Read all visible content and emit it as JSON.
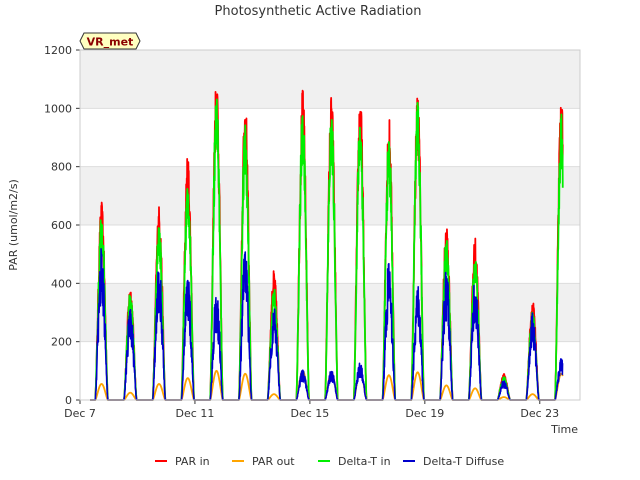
{
  "chart_data": {
    "type": "line",
    "title": "Photosynthetic Active Radiation",
    "xlabel": "Time",
    "ylabel": "PAR (umol/m2/s)",
    "site_label": "VR_met",
    "xlim": [
      0,
      17.4
    ],
    "ylim": [
      0,
      1200
    ],
    "yticks": [
      0,
      200,
      400,
      600,
      800,
      1000,
      1200
    ],
    "xticks": [
      {
        "value": 0,
        "label": "Dec 7"
      },
      {
        "value": 4,
        "label": "Dec 11"
      },
      {
        "value": 8,
        "label": "Dec 15"
      },
      {
        "value": 12,
        "label": "Dec 19"
      },
      {
        "value": 16,
        "label": "Dec 23"
      }
    ],
    "band_colors": [
      "#ffffff",
      "#f0f0f0"
    ],
    "grid": true,
    "legend_position": "bottom",
    "daily_peaks_day_offsets": [
      0.75,
      1.75,
      2.75,
      3.75,
      4.75,
      5.75,
      6.75,
      7.75,
      8.75,
      9.75,
      10.75,
      11.75,
      12.75,
      13.75,
      14.75,
      15.75,
      16.75
    ],
    "series": [
      {
        "name": "PAR in",
        "color": "#ff0000",
        "daily_peaks": [
          680,
          395,
          670,
          845,
          1135,
          1040,
          445,
          1070,
          1055,
          1055,
          980,
          1065,
          605,
          560,
          90,
          345,
          1040
        ]
      },
      {
        "name": "PAR out",
        "color": "#ffa500",
        "daily_peaks": [
          55,
          25,
          55,
          75,
          100,
          90,
          20,
          100,
          95,
          100,
          85,
          95,
          50,
          40,
          10,
          20,
          90
        ]
      },
      {
        "name": "Delta-T in",
        "color": "#00ee00",
        "daily_peaks": [
          640,
          370,
          600,
          760,
          1065,
          950,
          385,
          1000,
          995,
          995,
          910,
          1025,
          560,
          500,
          80,
          305,
          985
        ]
      },
      {
        "name": "Delta-T Diffuse",
        "color": "#0000cc",
        "daily_peaks": [
          530,
          325,
          470,
          440,
          380,
          535,
          320,
          105,
          105,
          130,
          485,
          395,
          450,
          420,
          70,
          300,
          145
        ]
      }
    ]
  }
}
